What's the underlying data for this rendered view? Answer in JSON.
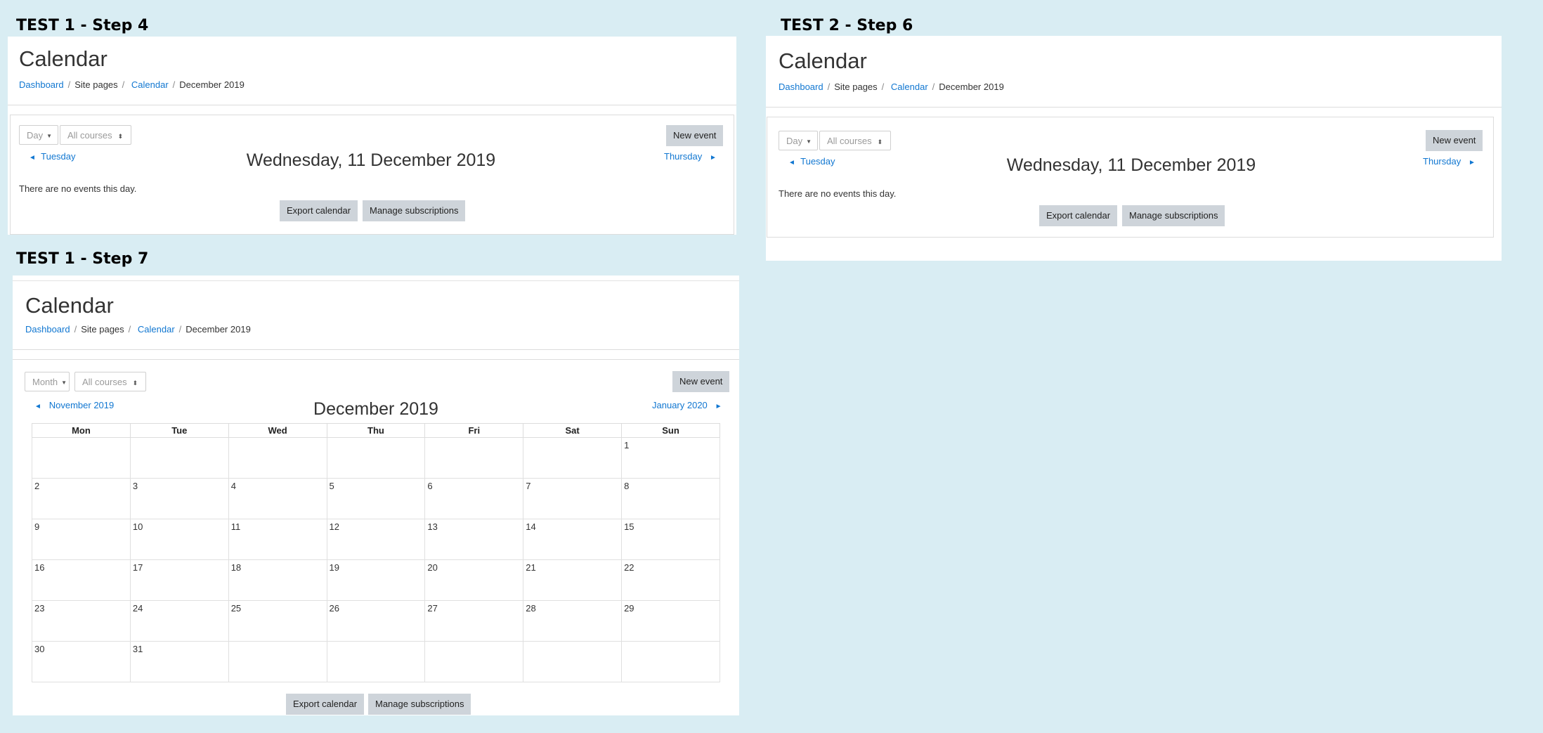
{
  "captions": {
    "test1_step4": "TEST 1 - Step 4",
    "test2_step6": "TEST 2 - Step 6",
    "test1_step7": "TEST 1 - Step 7"
  },
  "page_title": "Calendar",
  "breadcrumb": {
    "dashboard": "Dashboard",
    "site_pages": "Site pages",
    "calendar": "Calendar",
    "current": "December 2019"
  },
  "courses_select": "All courses",
  "new_event": "New event",
  "export_calendar": "Export calendar",
  "manage_subscriptions": "Manage subscriptions",
  "day_view": {
    "view_select": "Day",
    "prev": "Tuesday",
    "next": "Thursday",
    "heading": "Wednesday, 11 December 2019",
    "no_events": "There are no events this day."
  },
  "month_view": {
    "view_select": "Month",
    "prev": "November 2019",
    "next": "January 2020",
    "heading": "December 2019",
    "weekdays": [
      "Mon",
      "Tue",
      "Wed",
      "Thu",
      "Fri",
      "Sat",
      "Sun"
    ],
    "weeks": [
      [
        "",
        "",
        "",
        "",
        "",
        "",
        "1"
      ],
      [
        "2",
        "3",
        "4",
        "5",
        "6",
        "7",
        "8"
      ],
      [
        "9",
        "10",
        "11",
        "12",
        "13",
        "14",
        "15"
      ],
      [
        "16",
        "17",
        "18",
        "19",
        "20",
        "21",
        "22"
      ],
      [
        "23",
        "24",
        "25",
        "26",
        "27",
        "28",
        "29"
      ],
      [
        "30",
        "31",
        "",
        "",
        "",
        "",
        ""
      ]
    ]
  },
  "icons": {
    "prev": "◄",
    "next": "►",
    "caret": "▼",
    "updown": "⬍"
  },
  "colors": {
    "background": "#d9edf3",
    "link": "#1177d1",
    "button": "#ced4da"
  }
}
